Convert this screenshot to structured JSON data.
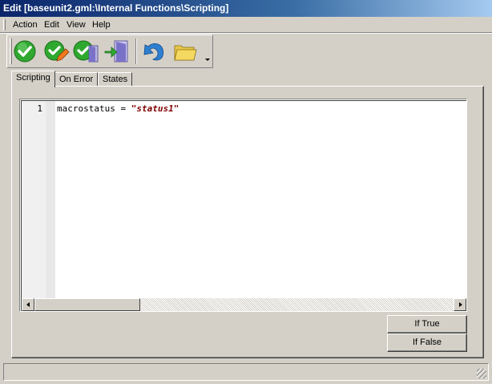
{
  "window": {
    "title": "Edit [baseunit2.gml:\\Internal Functions\\Scripting]"
  },
  "menu": {
    "items": [
      {
        "label": "Action"
      },
      {
        "label": "Edit"
      },
      {
        "label": "View"
      },
      {
        "label": "Help"
      }
    ]
  },
  "toolbar": {
    "buttons": [
      {
        "icon": "check-icon",
        "tooltip": ""
      },
      {
        "icon": "check-edit-icon",
        "tooltip": ""
      },
      {
        "icon": "check-door-icon",
        "tooltip": ""
      },
      {
        "icon": "exit-door-icon",
        "tooltip": ""
      },
      {
        "icon": "undo-icon",
        "tooltip": ""
      },
      {
        "icon": "folder-icon",
        "tooltip": ""
      }
    ],
    "colors": {
      "check_green": "#2fa82f",
      "edit_orange": "#f07820",
      "door_purple": "#7a72c8",
      "undo_blue": "#2f7fd0",
      "folder_yellow": "#f5d860"
    }
  },
  "tabs": [
    {
      "label": "Scripting",
      "active": true
    },
    {
      "label": "On Error",
      "active": false
    },
    {
      "label": "States",
      "active": false
    }
  ],
  "editor": {
    "lines": [
      {
        "number": "1",
        "ident": "macrostatus",
        "op": " = ",
        "string": "\"status1\""
      }
    ],
    "colors": {
      "string": "#800000"
    }
  },
  "buttons": {
    "if_true": "If True",
    "if_false": "If False"
  }
}
